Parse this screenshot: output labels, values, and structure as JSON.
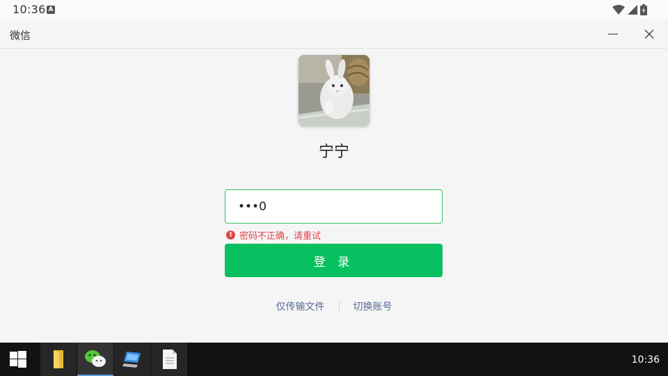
{
  "status_bar": {
    "time": "10:36",
    "badge": "A"
  },
  "window": {
    "title": "微信"
  },
  "profile": {
    "name": "宁宁"
  },
  "password": {
    "value": "•••0"
  },
  "error": {
    "message": "密码不正确，请重试"
  },
  "login_label": "登 录",
  "links": {
    "file_transfer": "仅传输文件",
    "switch_account": "切换账号"
  },
  "taskbar": {
    "time": "10:36"
  },
  "colors": {
    "accent": "#07c160",
    "error": "#e0454b",
    "link": "#576b95"
  }
}
